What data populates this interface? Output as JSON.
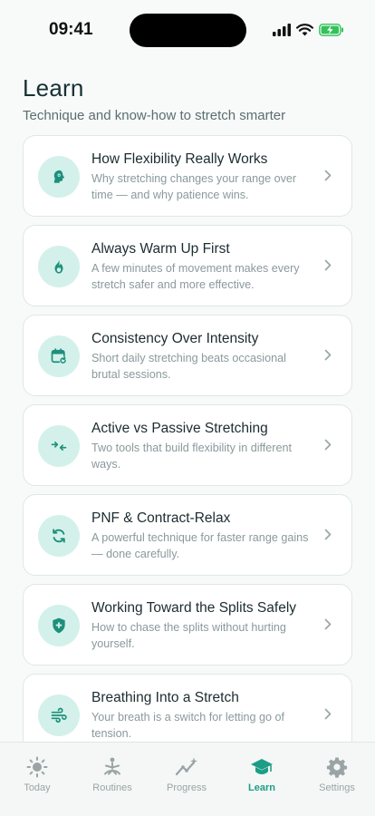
{
  "status": {
    "time": "09:41"
  },
  "header": {
    "title": "Learn",
    "subtitle": "Technique and know-how to stretch smarter"
  },
  "articles": [
    {
      "title": "How Flexibility Really Works",
      "description": "Why stretching changes your range over time — and why patience wins.",
      "icon": "brain-head-icon"
    },
    {
      "title": "Always Warm Up First",
      "description": "A few minutes of movement makes every stretch safer and more effective.",
      "icon": "flame-icon"
    },
    {
      "title": "Consistency Over Intensity",
      "description": "Short daily stretching beats occasional brutal sessions.",
      "icon": "calendar-repeat-icon"
    },
    {
      "title": "Active vs Passive Stretching",
      "description": "Two tools that build flexibility in different ways.",
      "icon": "arrows-inward-icon"
    },
    {
      "title": "PNF & Contract-Relax",
      "description": "A powerful technique for faster range gains — done carefully.",
      "icon": "cycle-arrows-icon"
    },
    {
      "title": "Working Toward the Splits Safely",
      "description": "How to chase the splits without hurting yourself.",
      "icon": "shield-plus-icon"
    },
    {
      "title": "Breathing Into a Stretch",
      "description": "Your breath is a switch for letting go of tension.",
      "icon": "wind-icon"
    }
  ],
  "tabs": [
    {
      "label": "Today",
      "icon": "sun-icon",
      "active": false
    },
    {
      "label": "Routines",
      "icon": "yoga-figure-icon",
      "active": false
    },
    {
      "label": "Progress",
      "icon": "trend-sparkle-icon",
      "active": false
    },
    {
      "label": "Learn",
      "icon": "graduation-cap-icon",
      "active": true
    },
    {
      "label": "Settings",
      "icon": "gear-icon",
      "active": false
    }
  ],
  "colors": {
    "accent": "#1e9d86",
    "icon_bg": "#d3f1ea",
    "inactive_tab": "#9aa4a5"
  }
}
